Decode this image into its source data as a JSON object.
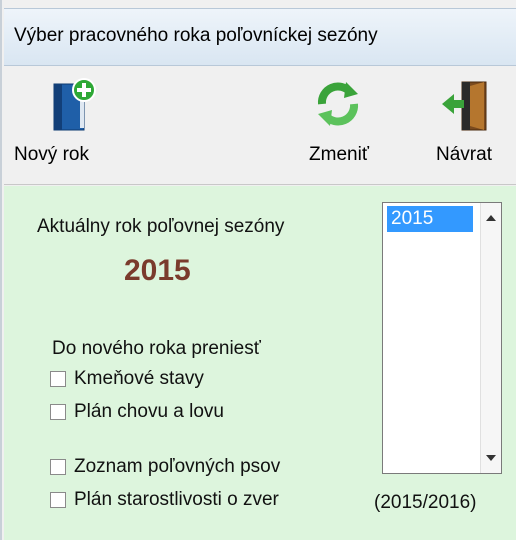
{
  "window": {
    "title": "Výber pracovného roka poľovníckej sezóny"
  },
  "toolbar": {
    "new_year_label": "Nový rok",
    "change_label": "Zmeniť",
    "return_label": "Návrat"
  },
  "main": {
    "current_year_label": "Aktuálny rok poľovnej sezóny",
    "current_year": "2015",
    "transfer_label": "Do nového roka preniesť",
    "checkboxes": [
      {
        "label": "Kmeňové stavy",
        "checked": false
      },
      {
        "label": "Plán chovu a lovu",
        "checked": false
      },
      {
        "label": "Zoznam  poľovných psov",
        "checked": false
      },
      {
        "label": "Plán starostlivosti o zver",
        "checked": false
      }
    ],
    "year_list": {
      "items": [
        "2015"
      ],
      "selected": "2015"
    },
    "season_range": "(2015/2016)"
  },
  "colors": {
    "content_bg": "#ddf5dd",
    "year_color": "#7a3b2c",
    "selection": "#3399ff"
  }
}
